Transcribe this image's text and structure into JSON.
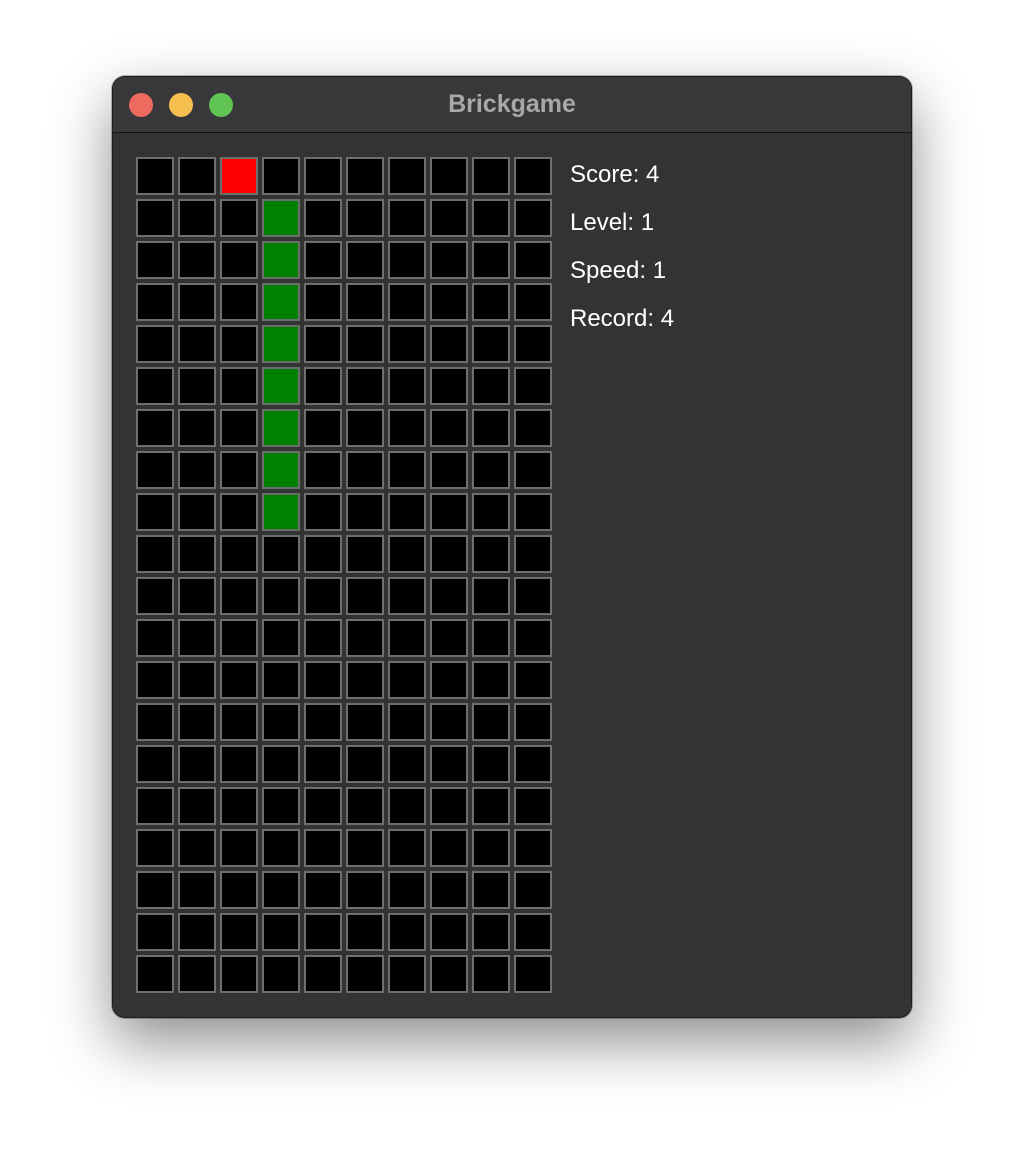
{
  "window": {
    "title": "Brickgame"
  },
  "board": {
    "columns": 10,
    "rows": 20,
    "colors": {
      "empty": "#000000",
      "border": "#6e6e6e",
      "food": "#ff0000",
      "snake": "#008000"
    },
    "food": [
      {
        "col": 2,
        "row": 0
      }
    ],
    "snake": [
      {
        "col": 3,
        "row": 1
      },
      {
        "col": 3,
        "row": 2
      },
      {
        "col": 3,
        "row": 3
      },
      {
        "col": 3,
        "row": 4
      },
      {
        "col": 3,
        "row": 5
      },
      {
        "col": 3,
        "row": 6
      },
      {
        "col": 3,
        "row": 7
      },
      {
        "col": 3,
        "row": 8
      }
    ]
  },
  "stats": {
    "score": "Score: 4",
    "level": "Level: 1",
    "speed": "Speed: 1",
    "record": "Record: 4"
  }
}
